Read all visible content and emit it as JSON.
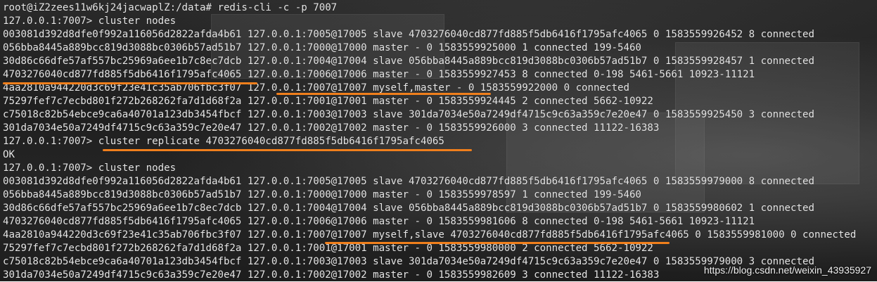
{
  "terminal": {
    "lines": [
      "root@iZ2zees11w6kj24jacwaplZ:/data# redis-cli -c -p 7007",
      "127.0.0.1:7007> cluster nodes",
      "003081d392d8dfe0f992a116056d2822afda4b61 127.0.0.1:7005@17005 slave 4703276040cd877fd885f5db6416f1795afc4065 0 1583559926452 8 connected",
      "056bba8445a889bcc819d3088bc0306b57ad51b7 127.0.0.1:7000@17000 master - 0 1583559925000 1 connected 199-5460",
      "30d86c66dfe57af557bc25969a6ee1b7c8ec7dcb 127.0.0.1:7004@17004 slave 056bba8445a889bcc819d3088bc0306b57ad51b7 0 1583559928457 1 connected",
      "4703276040cd877fd885f5db6416f1795afc4065 127.0.0.1:7006@17006 master - 0 1583559927453 8 connected 0-198 5461-5661 10923-11121",
      "4aa2810a944220d3c69f23e41c35ab706fbc3f07 127.0.0.1:7007@17007 myself,master - 0 1583559922000 0 connected",
      "75297fef7c7ecbd801f272b268262fa7d1d68f2a 127.0.0.1:7001@17001 master - 0 1583559924445 2 connected 5662-10922",
      "c75018c82b54ebce9ca6a40701a123db3454fbcf 127.0.0.1:7003@17003 slave 301da7034e50a7249df4715c9c63a359c7e20e47 0 1583559925450 3 connected",
      "301da7034e50a7249df4715c9c63a359c7e20e47 127.0.0.1:7002@17002 master - 0 1583559926000 3 connected 11122-16383",
      "127.0.0.1:7007> cluster replicate 4703276040cd877fd885f5db6416f1795afc4065",
      "OK",
      "127.0.0.1:7007> cluster nodes",
      "003081d392d8dfe0f992a116056d2822afda4b61 127.0.0.1:7005@17005 slave 4703276040cd877fd885f5db6416f1795afc4065 0 1583559979000 8 connected",
      "056bba8445a889bcc819d3088bc0306b57ad51b7 127.0.0.1:7000@17000 master - 0 1583559978597 1 connected 199-5460",
      "30d86c66dfe57af557bc25969a6ee1b7c8ec7dcb 127.0.0.1:7004@17004 slave 056bba8445a889bcc819d3088bc0306b57ad51b7 0 1583559980602 1 connected",
      "4703276040cd877fd885f5db6416f1795afc4065 127.0.0.1:7006@17006 master - 0 1583559981606 8 connected 0-198 5461-5661 10923-11121",
      "4aa2810a944220d3c69f23e41c35ab706fbc3f07 127.0.0.1:7007@17007 myself,slave 4703276040cd877fd885f5db6416f1795afc4065 0 1583559981000 0 connected",
      "75297fef7c7ecbd801f272b268262fa7d1d68f2a 127.0.0.1:7001@17001 master - 0 1583559980000 2 connected 5662-10922",
      "c75018c82b54ebce9ca6a40701a123db3454fbcf 127.0.0.1:7003@17003 slave 301da7034e50a7249df4715c9c63a359c7e20e47 0 1583559979000 3 connected",
      "301da7034e50a7249df4715c9c63a359c7e20e47 127.0.0.1:7002@17002 master - 0 1583559982609 3 connected 11122-16383"
    ]
  },
  "watermark": "https://blog.csdn.net/weixin_43935927",
  "colors": {
    "highlight": "#f07f1c",
    "text": "#e6e6e6"
  }
}
